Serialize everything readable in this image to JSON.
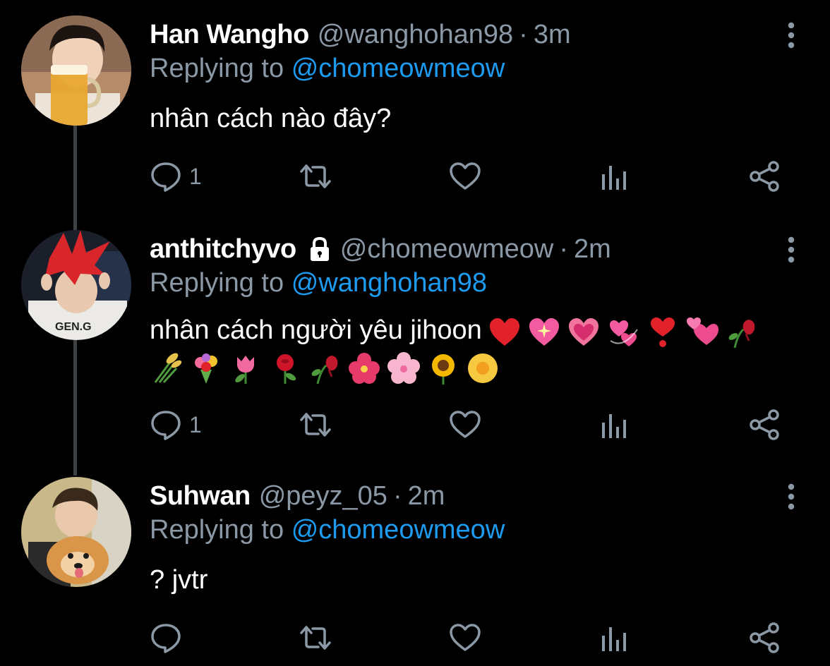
{
  "tweets": [
    {
      "name": "Han Wangho",
      "handle": "@wanghohan98",
      "separator": "·",
      "time": "3m",
      "replying_prefix": "Replying to",
      "replying_to": "@chomeowmeow",
      "text": "nhân cách nào đây?",
      "reply_count": "1",
      "locked": false
    },
    {
      "name": "anthitchyvo",
      "handle": "@chomeowmeow",
      "separator": "·",
      "time": "2m",
      "replying_prefix": "Replying to",
      "replying_to": "@wanghohan98",
      "text": "nhân cách người yêu jihoon",
      "reply_count": "1",
      "locked": true,
      "emojis_line1": [
        "red-heart",
        "sparkling-heart",
        "growing-heart",
        "revolving-hearts",
        "heart-exclamation",
        "two-hearts",
        "wilted-flower"
      ],
      "emojis_line2": [
        "sheaf-of-rice",
        "bouquet",
        "tulip",
        "rose",
        "wilted-flower",
        "hibiscus",
        "cherry-blossom",
        "sunflower",
        "blossom"
      ]
    },
    {
      "name": "Suhwan",
      "handle": "@peyz_05",
      "separator": "·",
      "time": "2m",
      "replying_prefix": "Replying to",
      "replying_to": "@chomeowmeow",
      "text": "? jvtr",
      "reply_count": "",
      "locked": false
    }
  ],
  "colors": {
    "background": "#000000",
    "name": "#ffffff",
    "secondary": "#8b98a5",
    "mention": "#1d9bf0",
    "thread_line": "#3e4144"
  },
  "icons": [
    "reply-icon",
    "retweet-icon",
    "like-icon",
    "analytics-icon",
    "share-icon",
    "more-icon",
    "lock-icon"
  ]
}
